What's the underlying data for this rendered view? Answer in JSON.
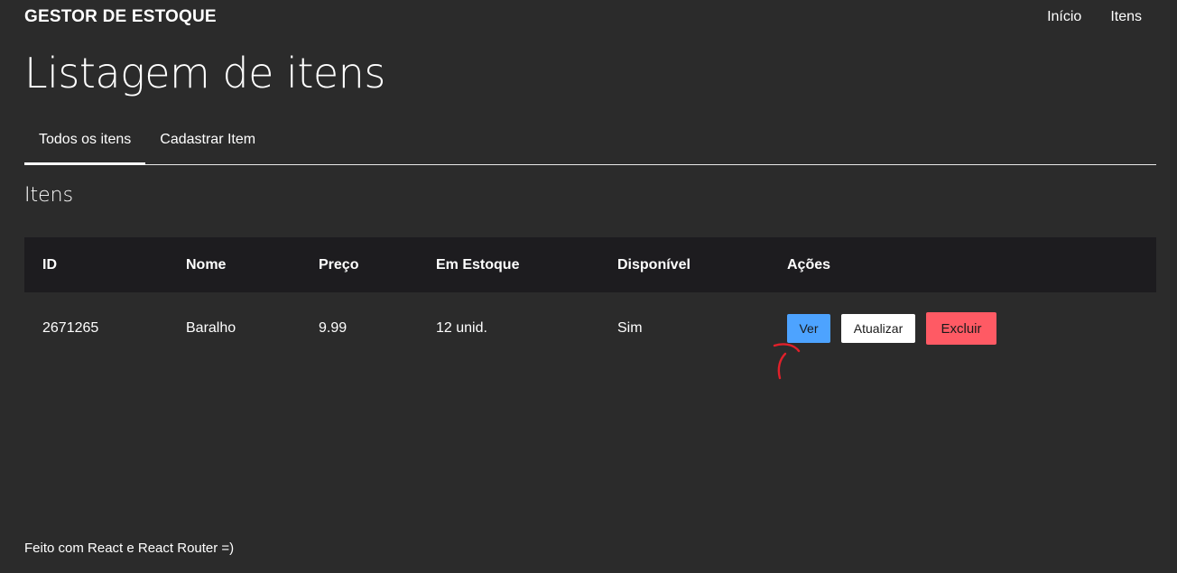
{
  "header": {
    "brand": "GESTOR DE ESTOQUE",
    "nav": [
      "Início",
      "Itens"
    ]
  },
  "page_title": "Listagem de itens",
  "tabs": [
    {
      "label": "Todos os itens",
      "active": true
    },
    {
      "label": "Cadastrar Item",
      "active": false
    }
  ],
  "section_title": "Itens",
  "table": {
    "columns": [
      "ID",
      "Nome",
      "Preço",
      "Em Estoque",
      "Disponível",
      "Ações"
    ],
    "rows": [
      {
        "id": "2671265",
        "nome": "Baralho",
        "preco": "9.99",
        "estoque": "12 unid.",
        "disponivel": "Sim"
      }
    ],
    "actions": {
      "ver": "Ver",
      "atualizar": "Atualizar",
      "excluir": "Excluir"
    }
  },
  "footer": "Feito com React e React Router =)",
  "colors": {
    "background": "#2b2b2b",
    "table_header": "#1d1c1f",
    "ver_button": "#4da3ff",
    "atualizar_button": "#ffffff",
    "excluir_button": "#ff5a64",
    "annotation": "#e0202a"
  }
}
